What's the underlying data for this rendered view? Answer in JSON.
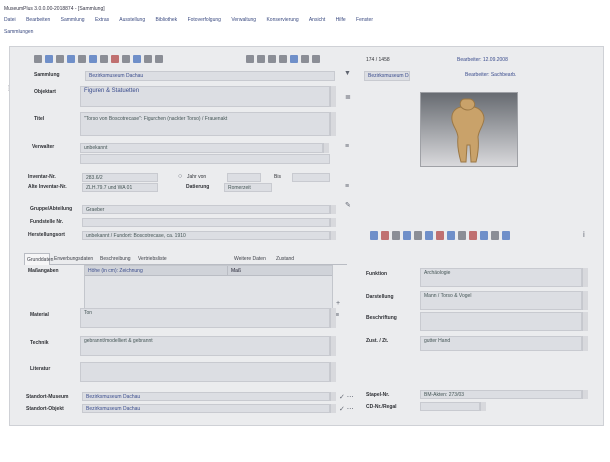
{
  "window": {
    "title": "MuseumPlus 3.0.0.00-2018874 - [Sammlung]"
  },
  "menu": [
    "Datei",
    "Bearbeiten",
    "Sammlung",
    "Extras",
    "Ausstellung",
    "Bibliothek",
    "Fotoverfolgung",
    "Verwaltung",
    "Konservierung",
    "Ansicht",
    "Hilfe",
    "Fenster"
  ],
  "subbar": {
    "label": "Sammlungen"
  },
  "record_nav": {
    "text": "174 / 1458"
  },
  "status_top_right": [
    "Bearbeiter: 12.09.2008",
    "Bearbeiter: Sachbearb."
  ],
  "form": {
    "sammlung": {
      "label": "Sammlung",
      "value": "Bezirksmuseum Dachau"
    },
    "objektart": {
      "label": "Objektart",
      "value": "Figuren & Statuetten"
    },
    "titel": {
      "label": "Titel",
      "value": "\"Torso von Boscotrecase\": Figurchen (nackter Torso) / Frauenakt"
    },
    "inventar": {
      "label": "Verwalter",
      "value": "unbekannt"
    },
    "inventar_nr": {
      "label": "Inventar-Nr.",
      "value": "283.6/2"
    },
    "alte_inventar_nr": {
      "label": "Alte Inventar-Nr.",
      "value": "ZLH.79.7 und WA 01"
    },
    "jahr_label": "Jahr von",
    "bis_label": "Bis",
    "datierung": {
      "label": "Datierung",
      "value": "Romerzeit"
    },
    "gruppe": {
      "label": "Gruppe/Abteilung",
      "value": "Graeber"
    },
    "fundstelle": {
      "label": "Fundstelle Nr.",
      "value": ""
    },
    "herstellungsort": {
      "label": "Herstellungsort",
      "value": "unbekannt / Fundort: Boscotrecase, ca. 1910"
    }
  },
  "tabs": [
    "Grunddaten",
    "Erwerbungsdaten",
    "Beschreibung",
    "Vertriebsliste",
    "Weitere Daten",
    "Zustand"
  ],
  "material_table": {
    "label": "Maßangaben",
    "col1": "Höhe (in cm): Zeichnung",
    "col2": "Maß"
  },
  "lower_left": {
    "material": {
      "label": "Material",
      "value": "Ton"
    },
    "technik": {
      "label": "Technik",
      "value": "gebrannt/modelliert & gebrannt"
    },
    "literatur": {
      "label": "Literatur",
      "value": ""
    },
    "standort_museum": {
      "label": "Standort-Museum",
      "value": "Bezirksmuseum Dachau"
    },
    "standort_aktuell": {
      "label": "Standort-Objekt",
      "value": "Bezirksmuseum Dachau"
    }
  },
  "lower_right": {
    "provenienz": {
      "label": "Funktion",
      "value": "Archäologie"
    },
    "darstellung": {
      "label": "Darstellung",
      "value": "Mann / Torso & Vogel"
    },
    "beschriftung": {
      "label": "Beschriftung",
      "value": ""
    },
    "zust": {
      "label": "Zust. / Zt.",
      "value": "gutter Hand"
    },
    "ausgabe": {
      "label": "Stapel-Nr.",
      "value": "BM-Akten: 273/03"
    },
    "cd": {
      "label": "CD-Nr./Regal",
      "value": ""
    }
  },
  "colors": {
    "frame": "#ebecee",
    "field": "#dcdee3",
    "link_text": "#3a4c8d",
    "window": "#ffffff"
  },
  "icons": [
    "new-icon",
    "save-icon",
    "delete-icon",
    "print-icon",
    "search-icon",
    "copy-icon",
    "first-record-icon",
    "previous-record-icon",
    "next-record-icon",
    "last-record-icon",
    "image-icon"
  ]
}
